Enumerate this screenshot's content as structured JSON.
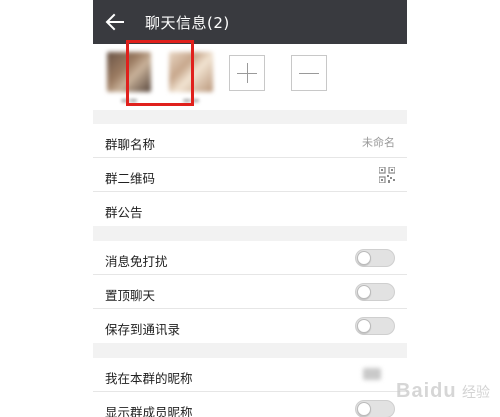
{
  "header": {
    "title": "聊天信息(2)",
    "back_icon": "back-arrow-icon"
  },
  "members": {
    "add_icon": "plus-icon",
    "remove_icon": "minus-icon",
    "highlight_color": "#e0201c"
  },
  "settings_group_1": {
    "group_name_label": "群聊名称",
    "group_name_value": "未命名",
    "qr_label": "群二维码",
    "qr_icon": "qr-code-icon",
    "notice_label": "群公告"
  },
  "settings_group_2": {
    "mute_label": "消息免打扰",
    "mute_on": false,
    "pin_label": "置顶聊天",
    "pin_on": false,
    "save_label": "保存到通讯录",
    "save_on": false
  },
  "settings_group_3": {
    "nickname_label": "我在本群的昵称",
    "show_nicknames_label": "显示群成员昵称",
    "show_nicknames_on": false
  },
  "watermark": {
    "logo": "Baidu",
    "suffix": "经验"
  },
  "colors": {
    "titlebar": "#393a3f",
    "background": "#f2f2f2",
    "highlight": "#e0201c"
  }
}
